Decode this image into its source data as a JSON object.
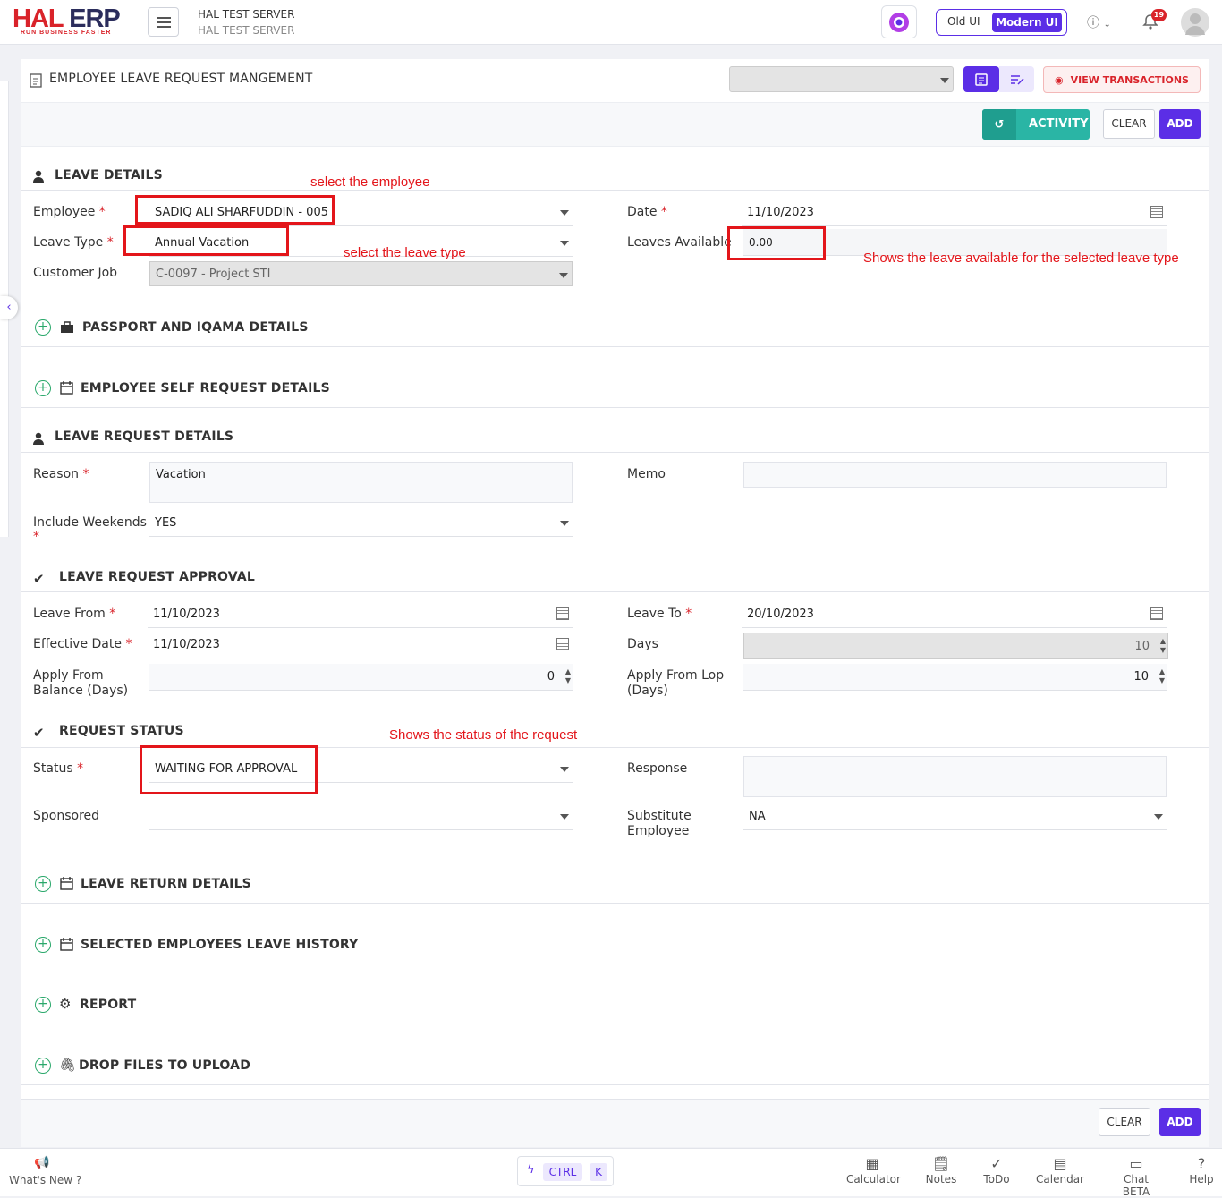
{
  "header": {
    "logo_hal": "HAL",
    "logo_erp": "ERP",
    "tagline": "RUN BUSINESS FASTER",
    "server_name": "HAL TEST SERVER",
    "server_sub": "HAL TEST SERVER",
    "ui_old": "Old UI",
    "ui_modern": "Modern UI",
    "notification_count": "19"
  },
  "page": {
    "title": "EMPLOYEE LEAVE REQUEST MANGEMENT",
    "view_transactions": "VIEW TRANSACTIONS",
    "activity": "ACTIVITY",
    "clear": "CLEAR",
    "add": "ADD"
  },
  "leave_details": {
    "title": "LEAVE DETAILS",
    "employee_label": "Employee",
    "employee_value": "SADIQ ALI  SHARFUDDIN - 005",
    "leave_type_label": "Leave Type",
    "leave_type_value": "Annual Vacation",
    "customer_job_label": "Customer Job",
    "customer_job_value": "C-0097 - Project STI",
    "date_label": "Date",
    "date_value": "11/10/2023",
    "leaves_available_label": "Leaves Available",
    "leaves_available_value": "0.00"
  },
  "annotations": {
    "select_employee": "select the employee",
    "select_leave_type": "select the leave type",
    "leave_available": "Shows the leave available for the selected leave type",
    "status_note": "Shows the status of the request"
  },
  "sections": {
    "passport": "PASSPORT AND IQAMA DETAILS",
    "self_request": "EMPLOYEE SELF REQUEST DETAILS",
    "leave_request_details": "LEAVE REQUEST DETAILS",
    "leave_request_approval": "LEAVE REQUEST APPROVAL",
    "request_status": "REQUEST STATUS",
    "leave_return": "LEAVE RETURN DETAILS",
    "leave_history": "SELECTED EMPLOYEES LEAVE HISTORY",
    "report": "REPORT",
    "drop_files": "DROP FILES TO UPLOAD"
  },
  "leave_request": {
    "reason_label": "Reason",
    "reason_value": "Vacation",
    "memo_label": "Memo",
    "weekends_label": "Include Weekends",
    "weekends_value": "YES"
  },
  "approval": {
    "leave_from_label": "Leave From",
    "leave_from_value": "11/10/2023",
    "leave_to_label": "Leave To",
    "leave_to_value": "20/10/2023",
    "effective_label": "Effective Date",
    "effective_value": "11/10/2023",
    "days_label": "Days",
    "days_value": "10",
    "apply_balance_label_1": "Apply From",
    "apply_balance_label_2": "Balance (Days)",
    "apply_balance_value": "0",
    "apply_lop_label_1": "Apply From Lop",
    "apply_lop_label_2": "(Days)",
    "apply_lop_value": "10"
  },
  "status": {
    "status_label": "Status",
    "status_value": "WAITING FOR APPROVAL",
    "response_label": "Response",
    "sponsored_label": "Sponsored",
    "substitute_label_1": "Substitute",
    "substitute_label_2": "Employee",
    "substitute_value": "NA"
  },
  "footer": {
    "whats_new": "What's New ?",
    "ctrl": "CTRL",
    "k": "K",
    "calculator": "Calculator",
    "notes": "Notes",
    "todo": "ToDo",
    "calendar": "Calendar",
    "chat": "Chat BETA",
    "help": "Help"
  }
}
